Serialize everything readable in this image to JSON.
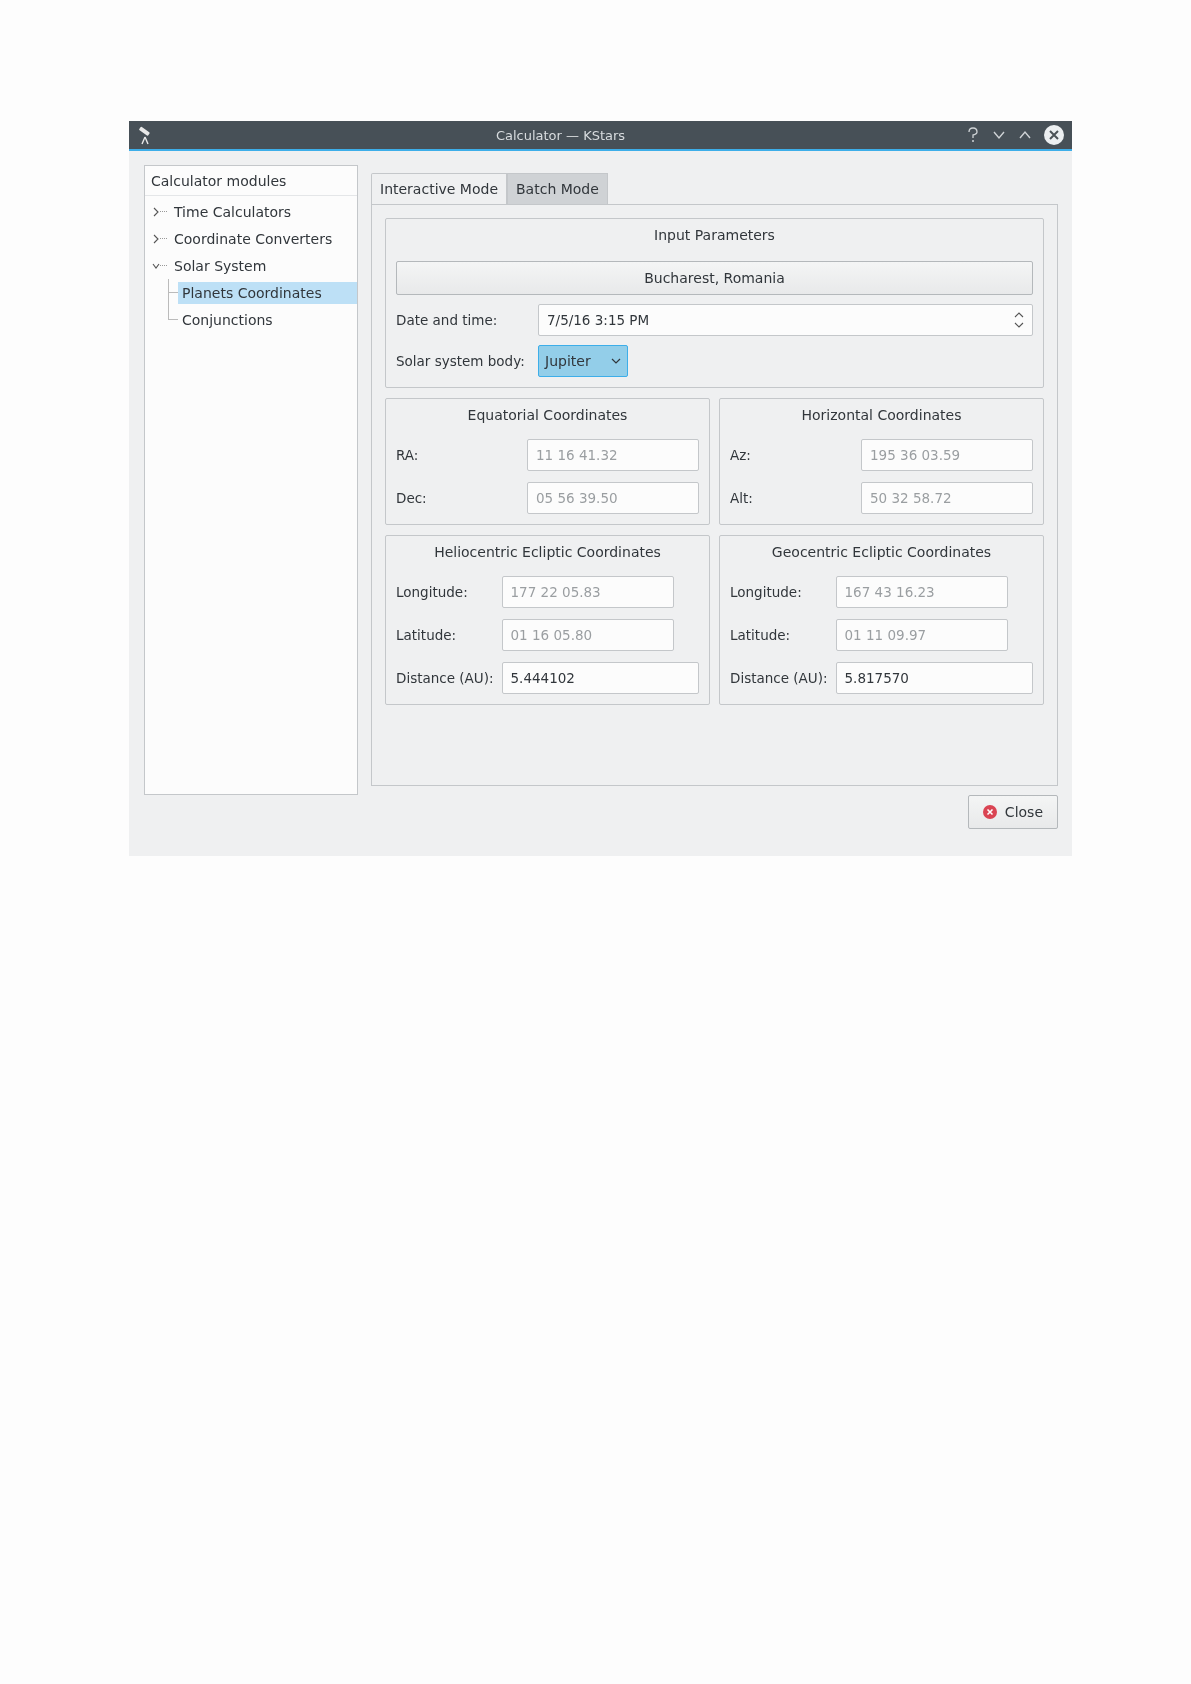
{
  "window": {
    "title": "Calculator — KStars"
  },
  "sidebar": {
    "header": "Calculator modules",
    "items": [
      {
        "label": "Time Calculators",
        "expanded": false,
        "selected": false
      },
      {
        "label": "Coordinate Converters",
        "expanded": false,
        "selected": false
      },
      {
        "label": "Solar System",
        "expanded": true,
        "selected": false,
        "children": [
          {
            "label": "Planets Coordinates",
            "selected": true
          },
          {
            "label": "Conjunctions",
            "selected": false
          }
        ]
      }
    ]
  },
  "tabs": [
    {
      "label": "Interactive Mode",
      "selected": true
    },
    {
      "label": "Batch Mode",
      "selected": false
    }
  ],
  "input_parameters": {
    "title": "Input Parameters",
    "location_button": "Bucharest, Romania",
    "date_time": {
      "label": "Date and time:",
      "value": "7/5/16 3:15 PM"
    },
    "body": {
      "label": "Solar system body:",
      "value": "Jupiter"
    }
  },
  "groups": [
    {
      "title": "Equatorial Coordinates",
      "kind": "aligned",
      "fields": [
        {
          "label": "RA:",
          "value": "11 16 41.32",
          "disabled": true
        },
        {
          "label": "Dec:",
          "value": "05 56 39.50",
          "disabled": true
        }
      ]
    },
    {
      "title": "Horizontal Coordinates",
      "kind": "aligned",
      "fields": [
        {
          "label": "Az:",
          "value": "195 36 03.59",
          "disabled": true
        },
        {
          "label": "Alt:",
          "value": "50 32 58.72",
          "disabled": true
        }
      ]
    },
    {
      "title": "Heliocentric Ecliptic Coordinates",
      "kind": "compact",
      "fields": [
        {
          "label": "Longitude:",
          "value": "177 22 05.83",
          "disabled": true
        },
        {
          "label": "Latitude:",
          "value": "01 16 05.80",
          "disabled": true
        },
        {
          "label": "Distance (AU):",
          "value": "5.444102",
          "disabled": false
        }
      ]
    },
    {
      "title": "Geocentric Ecliptic Coordinates",
      "kind": "compact",
      "fields": [
        {
          "label": "Longitude:",
          "value": "167 43 16.23",
          "disabled": true
        },
        {
          "label": "Latitude:",
          "value": "01 11 09.97",
          "disabled": true
        },
        {
          "label": "Distance (AU):",
          "value": "5.817570",
          "disabled": false
        }
      ]
    }
  ],
  "close_button": "Close"
}
